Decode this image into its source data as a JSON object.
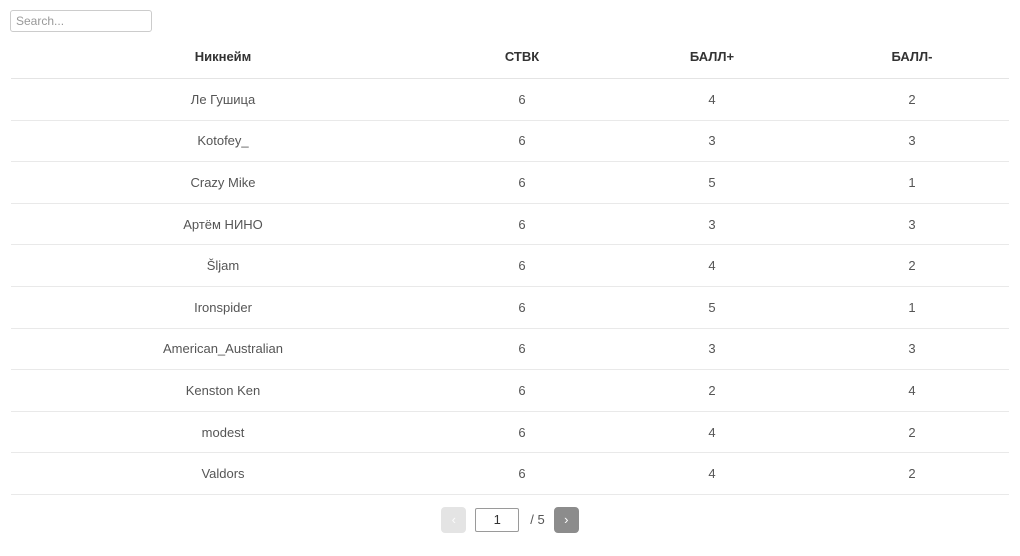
{
  "search": {
    "placeholder": "Search...",
    "value": ""
  },
  "table": {
    "columns": [
      {
        "key": "nickname",
        "label": "Никнейм"
      },
      {
        "key": "stvk",
        "label": "СТВК"
      },
      {
        "key": "score_plus",
        "label": "БАЛЛ+"
      },
      {
        "key": "score_minus",
        "label": "БАЛЛ-"
      }
    ],
    "rows": [
      {
        "nickname": "Ле Гушица",
        "stvk": "6",
        "score_plus": "4",
        "score_minus": "2"
      },
      {
        "nickname": "Kotofey_",
        "stvk": "6",
        "score_plus": "3",
        "score_minus": "3"
      },
      {
        "nickname": "Crazy Mike",
        "stvk": "6",
        "score_plus": "5",
        "score_minus": "1"
      },
      {
        "nickname": "Артём НИНО",
        "stvk": "6",
        "score_plus": "3",
        "score_minus": "3"
      },
      {
        "nickname": "Šljam",
        "stvk": "6",
        "score_plus": "4",
        "score_minus": "2"
      },
      {
        "nickname": "Ironspider",
        "stvk": "6",
        "score_plus": "5",
        "score_minus": "1"
      },
      {
        "nickname": "American_Australian",
        "stvk": "6",
        "score_plus": "3",
        "score_minus": "3"
      },
      {
        "nickname": "Kenston Ken",
        "stvk": "6",
        "score_plus": "2",
        "score_minus": "4"
      },
      {
        "nickname": "modest",
        "stvk": "6",
        "score_plus": "4",
        "score_minus": "2"
      },
      {
        "nickname": "Valdors",
        "stvk": "6",
        "score_plus": "4",
        "score_minus": "2"
      }
    ]
  },
  "pagination": {
    "prev_label": "‹",
    "next_label": "›",
    "current_page": "1",
    "total_label": "/ 5",
    "total_pages": "5",
    "prev_disabled": true,
    "next_disabled": false,
    "colors": {
      "prev_bg": "#e4e4e4",
      "next_bg": "#8c8c8c",
      "arrow": "#ffffff"
    }
  }
}
